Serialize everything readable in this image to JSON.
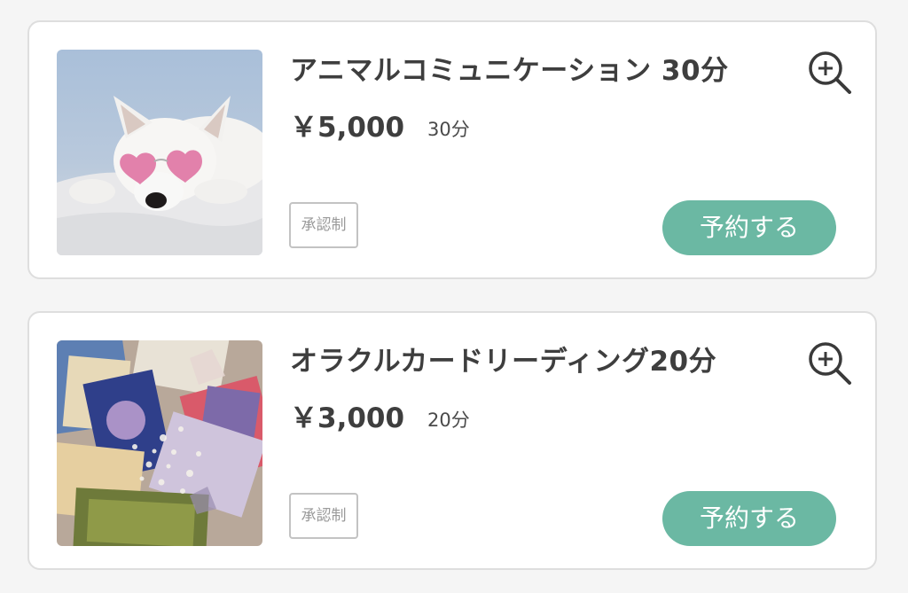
{
  "colors": {
    "accent": "#6bb8a3",
    "text": "#3e3e3e",
    "badge_border": "#c3c3c3"
  },
  "menus": [
    {
      "title": "アニマルコミュニケーション 30分",
      "price": "￥5,000",
      "duration": "30分",
      "badge": "承認制",
      "button_label": "予約する",
      "zoom_icon": "zoom-in-icon",
      "image": "white-dog-with-pink-heart-sunglasses"
    },
    {
      "title": "オラクルカードリーディング20分",
      "price": "￥3,000",
      "duration": "20分",
      "badge": "承認制",
      "button_label": "予約する",
      "zoom_icon": "zoom-in-icon",
      "image": "oracle-cards-and-crystals"
    }
  ]
}
